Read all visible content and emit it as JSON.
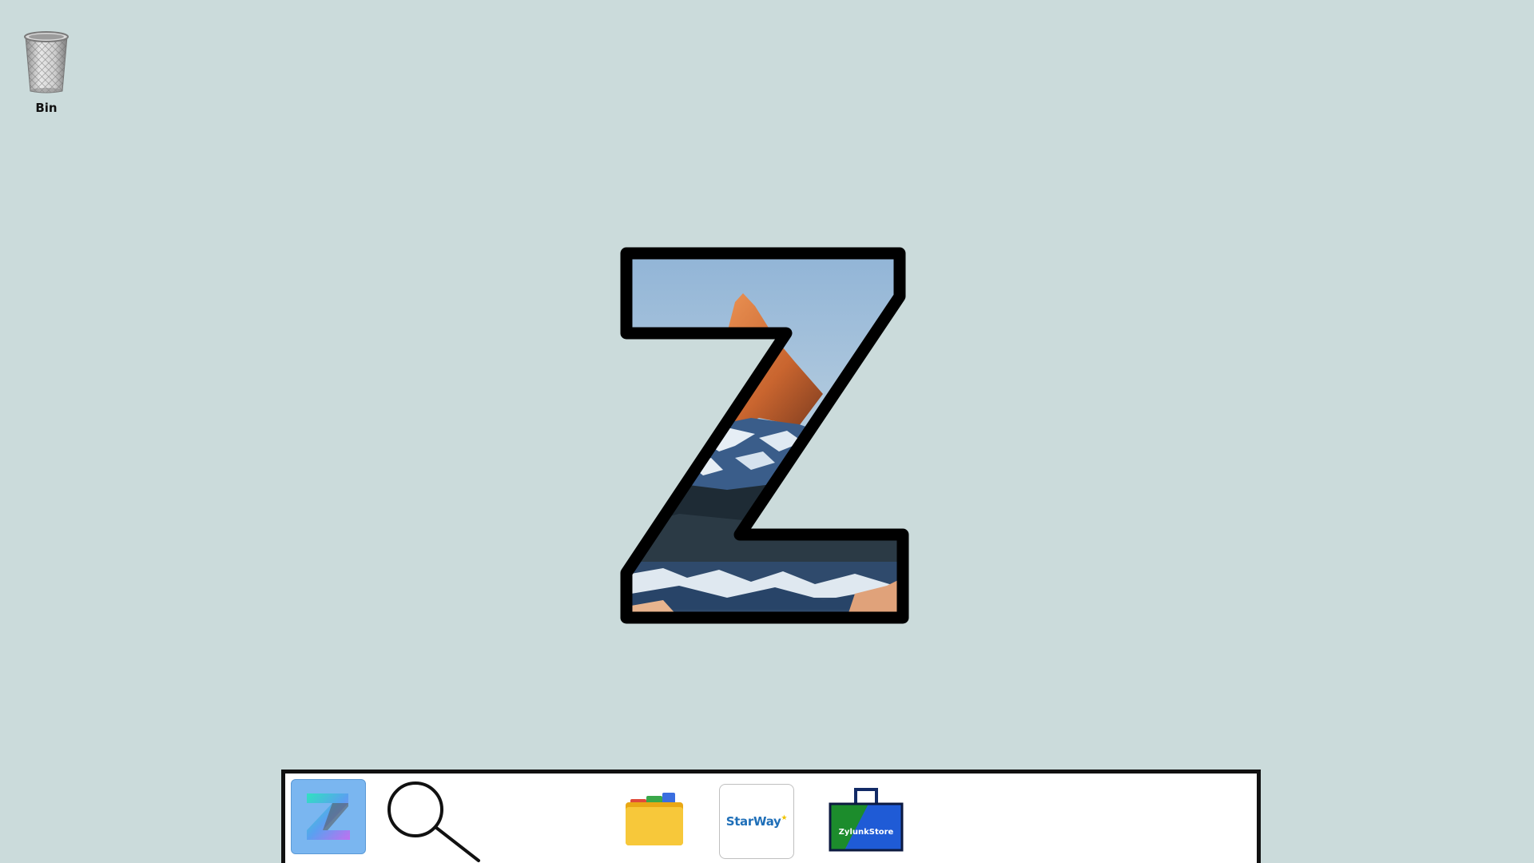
{
  "desktop": {
    "background_color": "#cbdbdb",
    "icons": [
      {
        "label": "Bin",
        "icon": "trash-bin-icon"
      }
    ]
  },
  "center_logo": {
    "letter": "Z",
    "icon": "z-mountain-logo"
  },
  "taskbar": {
    "items": [
      {
        "name": "z-app",
        "icon": "z-app-icon",
        "active": true
      },
      {
        "name": "search",
        "icon": "search-icon"
      },
      {
        "name": "files",
        "icon": "folder-icon"
      },
      {
        "name": "starway",
        "icon": "starway-browser-icon",
        "label": "StarWay"
      },
      {
        "name": "store",
        "icon": "store-bag-icon",
        "label": "ZylunkStore"
      }
    ]
  }
}
